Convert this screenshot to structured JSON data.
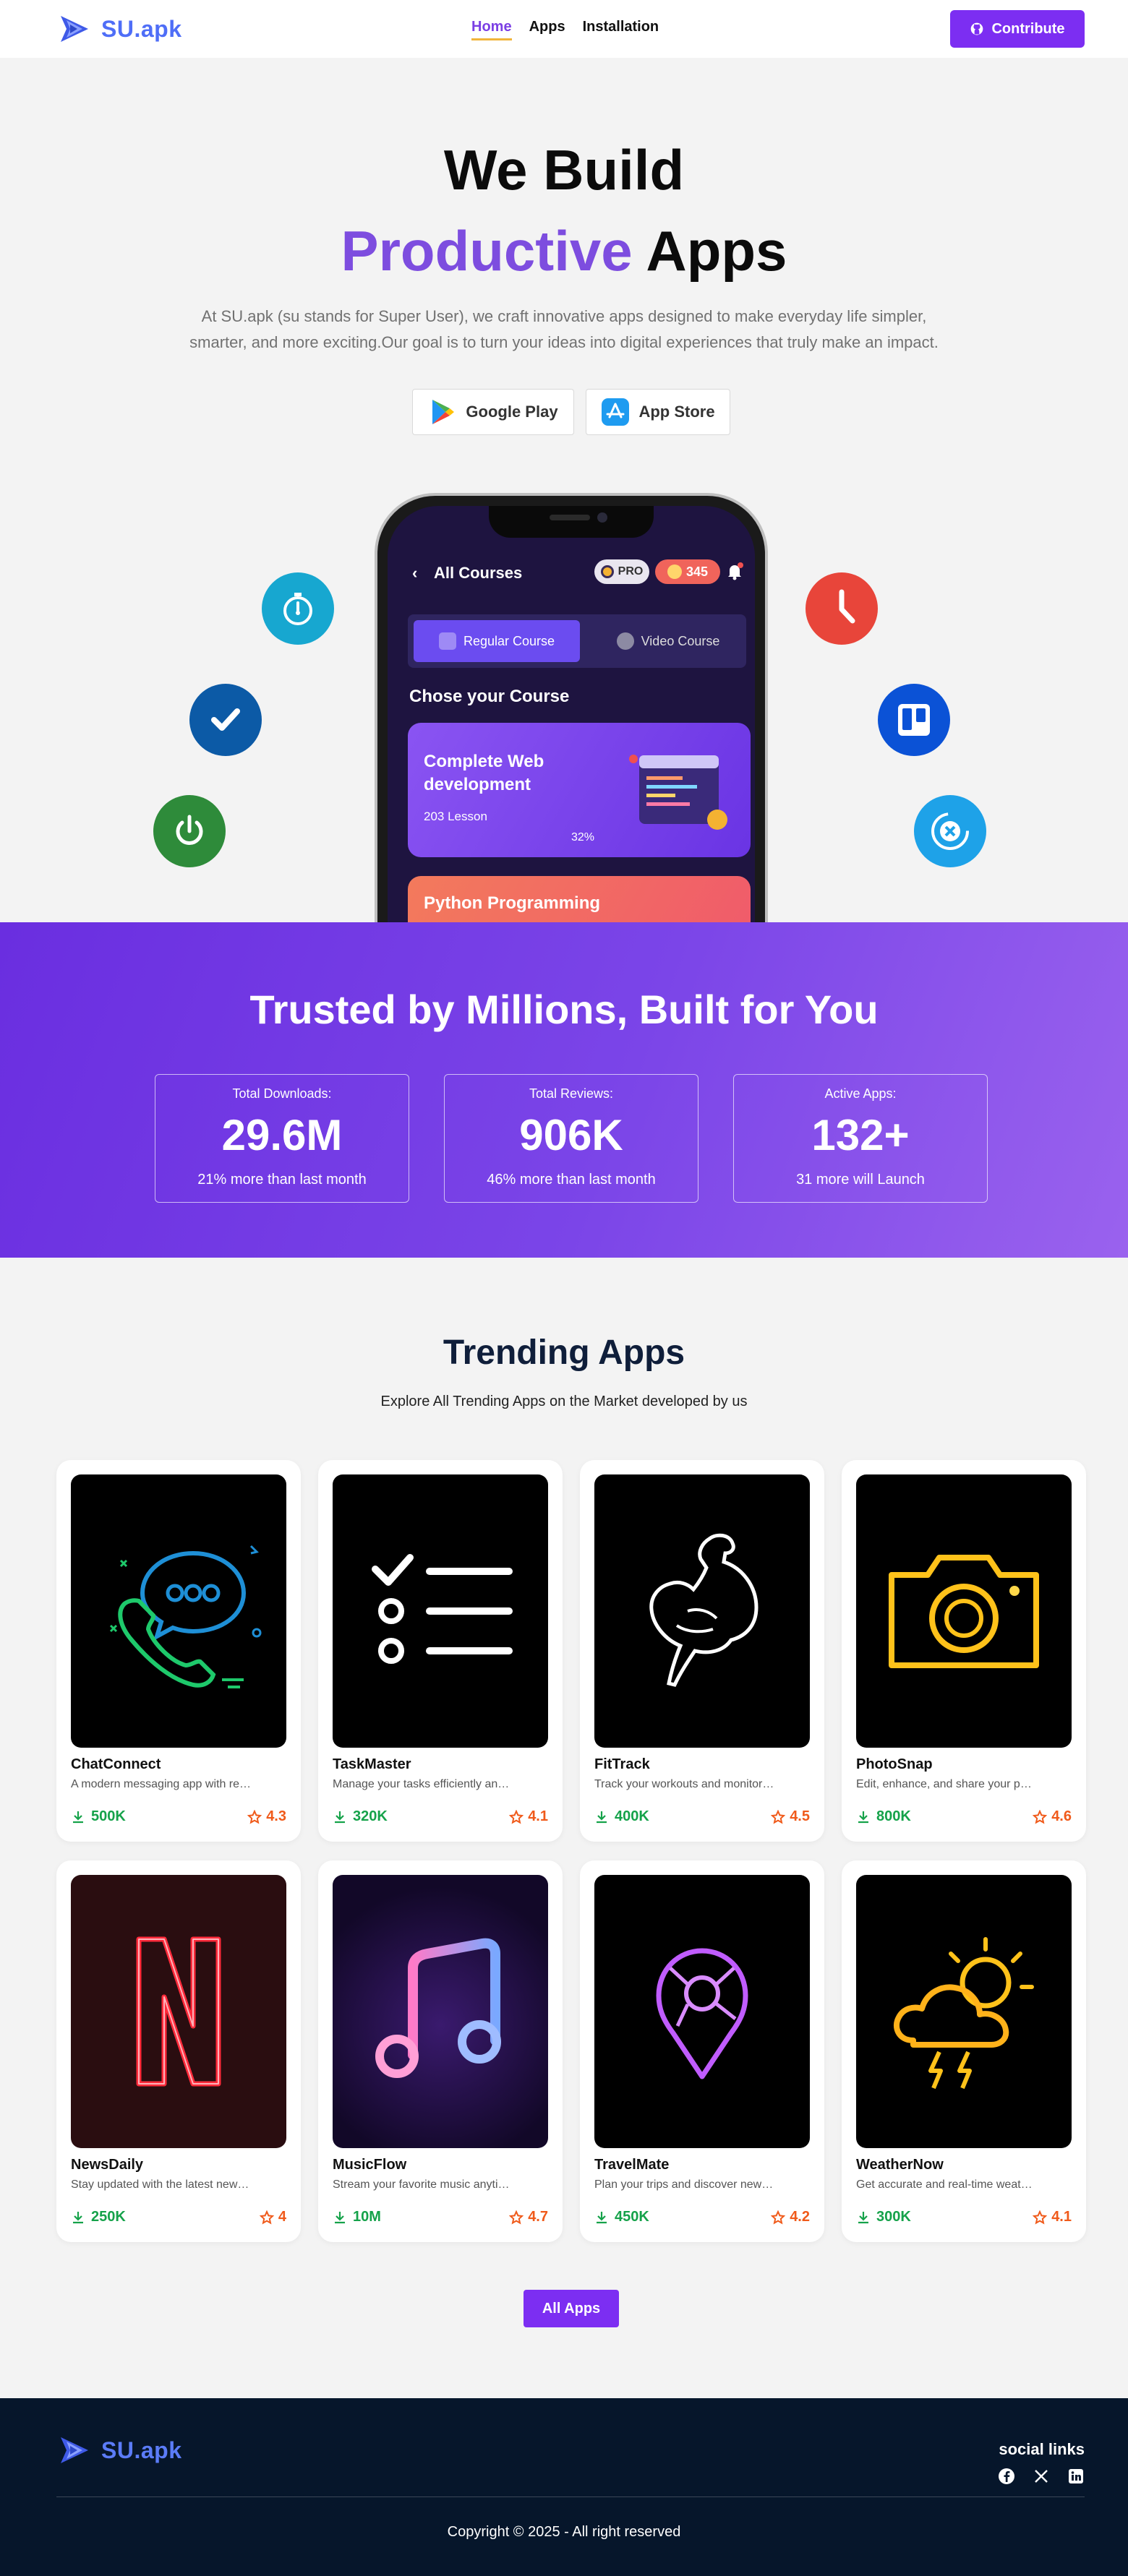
{
  "brand": {
    "name": "SU.apk"
  },
  "nav": {
    "links": [
      {
        "label": "Home",
        "active": true
      },
      {
        "label": "Apps",
        "active": false
      },
      {
        "label": "Installation",
        "active": false
      }
    ],
    "contribute_label": "Contribute",
    "contribute_icon": "github-icon"
  },
  "hero": {
    "title_line1": "We Build",
    "title_accent": "Productive",
    "title_rest": " Apps",
    "description": "At SU.apk (su stands for Super User), we craft innovative apps designed to make everyday life simpler, smarter, and more exciting.Our goal is to turn your ideas into digital experiences that truly make an impact.",
    "google_play_label": "Google Play",
    "app_store_label": "App Store",
    "accent_color": "#7d4ddf"
  },
  "phone_screen": {
    "back_glyph": "‹",
    "title": "All Courses",
    "pro_label": "PRO",
    "coins": "345",
    "tab_regular": "Regular Course",
    "tab_video": "Video Course",
    "section_title": "Chose your Course",
    "course1_title": "Complete Web development",
    "course1_lessons": "203 Lesson",
    "course1_progress": "32%",
    "course2_title": "Python Programming"
  },
  "floating_icons": [
    "stopwatch-icon",
    "check-icon",
    "power-icon",
    "clock-icon",
    "trello-icon",
    "bitcoin-sync-icon"
  ],
  "stats": {
    "title": "Trusted by Millions, Built for You",
    "cards": [
      {
        "label": "Total Downloads:",
        "value": "29.6M",
        "note": "21% more than last month"
      },
      {
        "label": "Total Reviews:",
        "value": "906K",
        "note": "46% more than last month"
      },
      {
        "label": "Active Apps:",
        "value": "132+",
        "note": "31 more will Launch"
      }
    ]
  },
  "trending": {
    "title": "Trending Apps",
    "subtitle": "Explore All Trending Apps on the Market developed by us",
    "apps": [
      {
        "name": "ChatConnect",
        "desc": "A modern messaging app with real-time chat",
        "downloads": "500K",
        "rating": "4.3",
        "icon": "chat-phone-icon"
      },
      {
        "name": "TaskMaster",
        "desc": "Manage your tasks efficiently and stay organized",
        "downloads": "320K",
        "rating": "4.1",
        "icon": "checklist-icon"
      },
      {
        "name": "FitTrack",
        "desc": "Track your workouts and monitor your progress",
        "downloads": "400K",
        "rating": "4.5",
        "icon": "muscle-icon"
      },
      {
        "name": "PhotoSnap",
        "desc": "Edit, enhance, and share your photos instantly",
        "downloads": "800K",
        "rating": "4.6",
        "icon": "camera-icon"
      },
      {
        "name": "NewsDaily",
        "desc": "Stay updated with the latest news every day",
        "downloads": "250K",
        "rating": "4",
        "icon": "netflix-n-icon"
      },
      {
        "name": "MusicFlow",
        "desc": "Stream your favorite music anytime, anywhere",
        "downloads": "10M",
        "rating": "4.7",
        "icon": "music-note-icon"
      },
      {
        "name": "TravelMate",
        "desc": "Plan your trips and discover new destinations",
        "downloads": "450K",
        "rating": "4.2",
        "icon": "map-pin-icon"
      },
      {
        "name": "WeatherNow",
        "desc": "Get accurate and real-time weather forecasts",
        "downloads": "300K",
        "rating": "4.1",
        "icon": "weather-storm-icon"
      }
    ],
    "all_apps_label": "All Apps"
  },
  "footer": {
    "brand": "SU.apk",
    "social_title": "social links",
    "social_icons": [
      "facebook-icon",
      "x-icon",
      "linkedin-icon"
    ],
    "copyright": "Copyright © 2025 - All right reserved"
  }
}
